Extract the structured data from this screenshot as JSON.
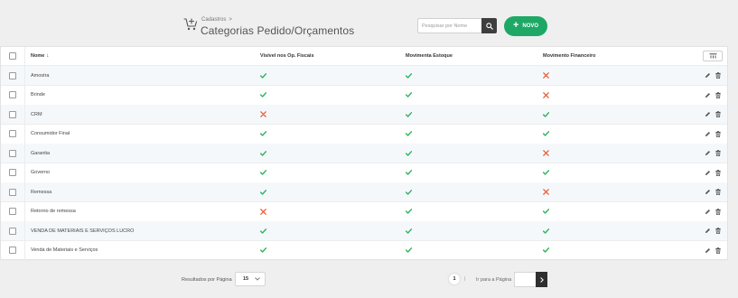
{
  "header": {
    "breadcrumb": "Cadastros",
    "breadcrumb_sep": ">",
    "title": "Categorias Pedido/Orçamentos",
    "search_placeholder": "Pesquisar por Nome",
    "new_button": "NOVO"
  },
  "table": {
    "columns": {
      "name": "Nome",
      "v1": "Visível nos Op. Fiscais",
      "v2": "Movimenta Estoque",
      "v3": "Movimento Financeiro"
    },
    "rows": [
      {
        "name": "Amostra",
        "v1": true,
        "v2": true,
        "v3": false
      },
      {
        "name": "Brinde",
        "v1": true,
        "v2": true,
        "v3": false
      },
      {
        "name": "CRM",
        "v1": false,
        "v2": true,
        "v3": true
      },
      {
        "name": "Consumidor Final",
        "v1": true,
        "v2": true,
        "v3": true
      },
      {
        "name": "Garantia",
        "v1": true,
        "v2": true,
        "v3": false
      },
      {
        "name": "Governo",
        "v1": true,
        "v2": true,
        "v3": true
      },
      {
        "name": "Remessa",
        "v1": true,
        "v2": true,
        "v3": false
      },
      {
        "name": "Retorno de remessa",
        "v1": false,
        "v2": true,
        "v3": true
      },
      {
        "name": "VENDA DE MATERIAIS E SERVIÇOS LUCRO",
        "v1": true,
        "v2": true,
        "v3": true
      },
      {
        "name": "Venda de Materiais e Serviços",
        "v1": true,
        "v2": true,
        "v3": true
      }
    ]
  },
  "footer": {
    "per_page_label": "Resultados por Página",
    "per_page_value": "15",
    "current_page": "1",
    "page_sep": "|",
    "goto_label": "Ir para a Página"
  },
  "colors": {
    "accent": "#1ea865",
    "check": "#2db45a",
    "cross": "#e8572f",
    "dark_button": "#3e3e3e"
  },
  "icons": {
    "page": "cart-plus-icon",
    "search": "search-icon",
    "new": "plus-icon",
    "columns": "columns-icon",
    "edit": "pencil-icon",
    "delete": "trash-icon",
    "true_value": "check-icon",
    "false_value": "cross-icon",
    "next": "chevron-right-icon"
  }
}
